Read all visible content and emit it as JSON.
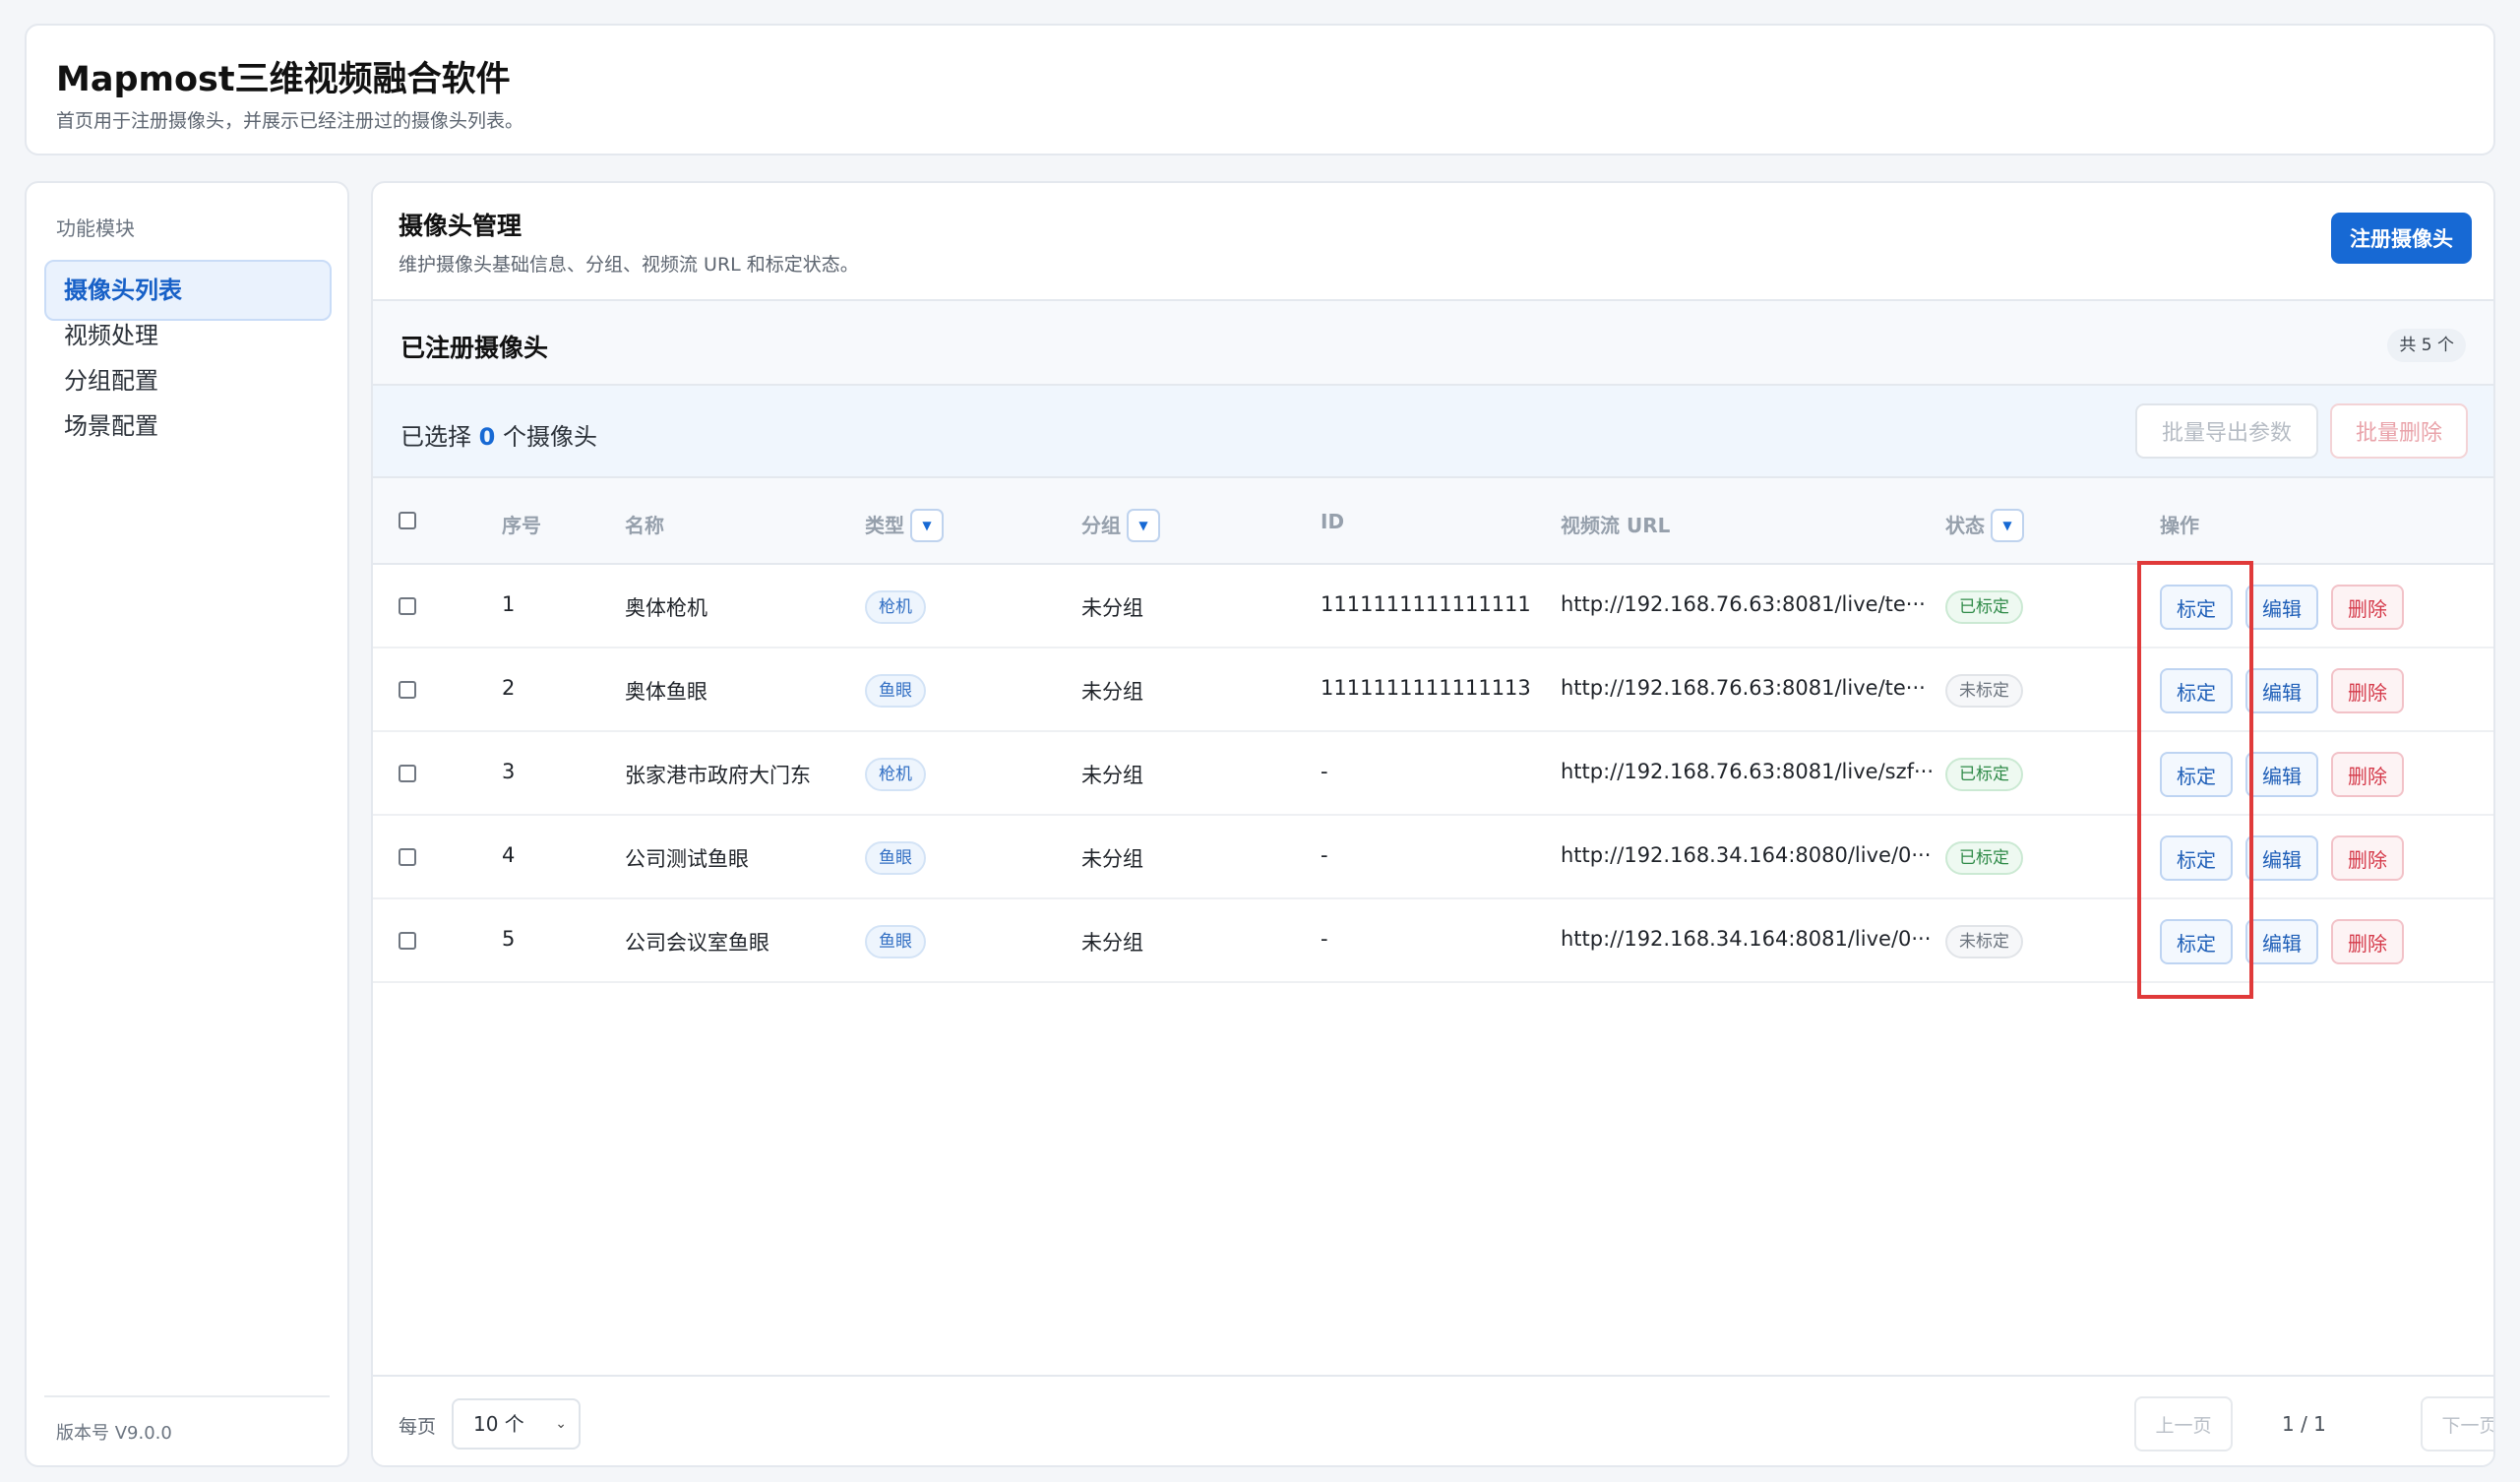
{
  "header": {
    "title": "Mapmost三维视频融合软件",
    "subtitle": "首页用于注册摄像头，并展示已经注册过的摄像头列表。"
  },
  "sidebar": {
    "section_label": "功能模块",
    "items": [
      {
        "label": "摄像头列表"
      },
      {
        "label": "视频处理"
      },
      {
        "label": "分组配置"
      },
      {
        "label": "场景配置"
      }
    ],
    "version": "版本号 V9.0.0"
  },
  "manager": {
    "title": "摄像头管理",
    "subtitle": "维护摄像头基础信息、分组、视频流 URL 和标定状态。",
    "register_label": "注册摄像头"
  },
  "registered": {
    "title": "已注册摄像头",
    "count": "共 5 个"
  },
  "selection": {
    "prefix": "已选择",
    "count": "0",
    "suffix": "个摄像头",
    "export_label": "批量导出参数",
    "delete_label": "批量删除"
  },
  "table": {
    "headers": {
      "index": "序号",
      "name": "名称",
      "type": "类型",
      "group": "分组",
      "id": "ID",
      "url": "视频流 URL",
      "status": "状态",
      "actions": "操作"
    },
    "action_labels": {
      "calibrate": "标定",
      "edit": "编辑",
      "delete": "删除"
    },
    "rows": [
      {
        "index": "1",
        "name": "奥体枪机",
        "type": "枪机",
        "group": "未分组",
        "id": "1111111111111111",
        "url": "http://192.168.76.63:8081/live/te···",
        "status": "已标定"
      },
      {
        "index": "2",
        "name": "奥体鱼眼",
        "type": "鱼眼",
        "group": "未分组",
        "id": "1111111111111113",
        "url": "http://192.168.76.63:8081/live/te···",
        "status": "未标定"
      },
      {
        "index": "3",
        "name": "张家港市政府大门东",
        "type": "枪机",
        "group": "未分组",
        "id": "-",
        "url": "http://192.168.76.63:8081/live/szf···",
        "status": "已标定"
      },
      {
        "index": "4",
        "name": "公司测试鱼眼",
        "type": "鱼眼",
        "group": "未分组",
        "id": "-",
        "url": "http://192.168.34.164:8080/live/0···",
        "status": "已标定"
      },
      {
        "index": "5",
        "name": "公司会议室鱼眼",
        "type": "鱼眼",
        "group": "未分组",
        "id": "-",
        "url": "http://192.168.34.164:8081/live/0···",
        "status": "未标定"
      }
    ]
  },
  "pagination": {
    "per_page_label": "每页",
    "per_page_value": "10 个",
    "prev_label": "上一页",
    "page_info": "1 / 1",
    "next_label": "下一页"
  },
  "colors": {
    "accent": "#1769d4",
    "highlight_box": "#e03a3a",
    "calibrated": "#2e8a47",
    "danger": "#d53a4a"
  }
}
